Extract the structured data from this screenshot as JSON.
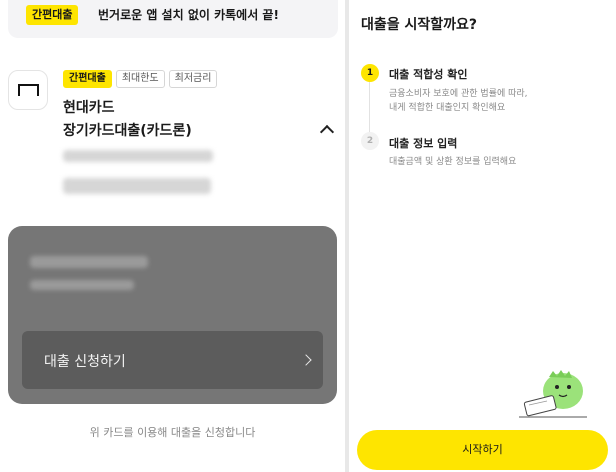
{
  "promo": {
    "badge": "간편대출",
    "text": "번거로운 앱 설치 없이 카톡에서 끝!"
  },
  "card": {
    "tags": [
      "간편대출",
      "최대한도",
      "최저금리"
    ],
    "issuer": "현대카드",
    "product": "장기카드대출(카드론)"
  },
  "panel": {
    "apply_button": "대출 신청하기"
  },
  "left_footnote": "위 카드를 이용해 대출을 신청합니다",
  "right": {
    "title": "대출을 시작할까요?",
    "steps": [
      {
        "number": "1",
        "title": "대출 적합성 확인",
        "desc_line1": "금융소비자 보호에 관한 법률에 따라,",
        "desc_line2": "내게 적합한 대출인지 확인해요"
      },
      {
        "number": "2",
        "title": "대출 정보 입력",
        "desc_line1": "대출금액 및 상환 정보를 입력해요"
      }
    ],
    "start_button": "시작하기"
  },
  "colors": {
    "accent": "#fee500",
    "panel": "#767676"
  },
  "icons": [
    "hyundai-card-logo-icon",
    "chevron-up-icon",
    "chevron-right-icon",
    "mascot-illustration"
  ]
}
